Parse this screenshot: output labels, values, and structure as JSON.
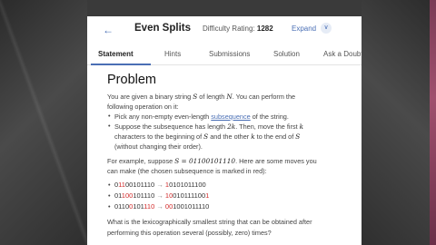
{
  "header": {
    "back_icon": "arrow-left-icon",
    "title": "Even Splits",
    "difficulty_label": "Difficulty Rating:",
    "difficulty_value": "1282",
    "expand_label": "Expand",
    "expand_icon": "chevron-down-icon"
  },
  "tabs": [
    {
      "label": "Statement",
      "active": true
    },
    {
      "label": "Hints",
      "active": false
    },
    {
      "label": "Submissions",
      "active": false
    },
    {
      "label": "Solution",
      "active": false
    },
    {
      "label": "Ask a Doubt",
      "active": false
    }
  ],
  "problem": {
    "heading": "Problem",
    "intro_line1_a": "You are given a binary string ",
    "intro_S": "S",
    "intro_line1_b": " of length ",
    "intro_N": "N",
    "intro_line1_c": ". You can perform the",
    "intro_line2": "following operation on it:",
    "bullet1_a": "Pick any non-empty even-length ",
    "bullet1_link": "subsequence",
    "bullet1_b": " of the string.",
    "bullet2_line1_a": "Suppose the subsequence has length ",
    "bullet2_2k": "2k",
    "bullet2_line1_b": ". Then, move the first ",
    "bullet2_k": "k",
    "bullet2_line2_a": "characters to the beginning of ",
    "bullet2_S": "S",
    "bullet2_line2_b": " and the other ",
    "bullet2_k2": "k",
    "bullet2_line2_c": " to the end of ",
    "bullet2_S2": "S",
    "bullet2_line3": "(without changing their order).",
    "example_line1_a": "For example, suppose ",
    "example_eq": "S = 01100101110",
    "example_line1_b": ". Here are some moves you",
    "example_line2": "can make (the chosen subsequence is marked in red):",
    "moves": [
      {
        "segments": [
          {
            "t": "0",
            "r": false
          },
          {
            "t": "11",
            "r": true
          },
          {
            "t": "00101110",
            "r": false
          }
        ],
        "arrow": "→",
        "result": [
          {
            "t": "1",
            "r": true
          },
          {
            "t": "0101011100",
            "r": false
          }
        ]
      },
      {
        "segments": [
          {
            "t": "01",
            "r": false
          },
          {
            "t": "100",
            "r": true
          },
          {
            "t": "101110",
            "r": false
          }
        ],
        "arrow": "→",
        "result": [
          {
            "t": "10",
            "r": true
          },
          {
            "t": "010111100",
            "r": false
          },
          {
            "t": "1",
            "r": true
          }
        ]
      },
      {
        "segments": [
          {
            "t": "0110",
            "r": false
          },
          {
            "t": "0",
            "r": true
          },
          {
            "t": "101",
            "r": false
          },
          {
            "t": "110",
            "r": true
          }
        ],
        "arrow": "→",
        "result": [
          {
            "t": "00",
            "r": true
          },
          {
            "t": "1001011110",
            "r": false
          }
        ]
      }
    ],
    "question_line1": "What is the lexicographically smallest string that can be obtained after",
    "question_line2": "performing this operation several (possibly, zero) times?"
  }
}
